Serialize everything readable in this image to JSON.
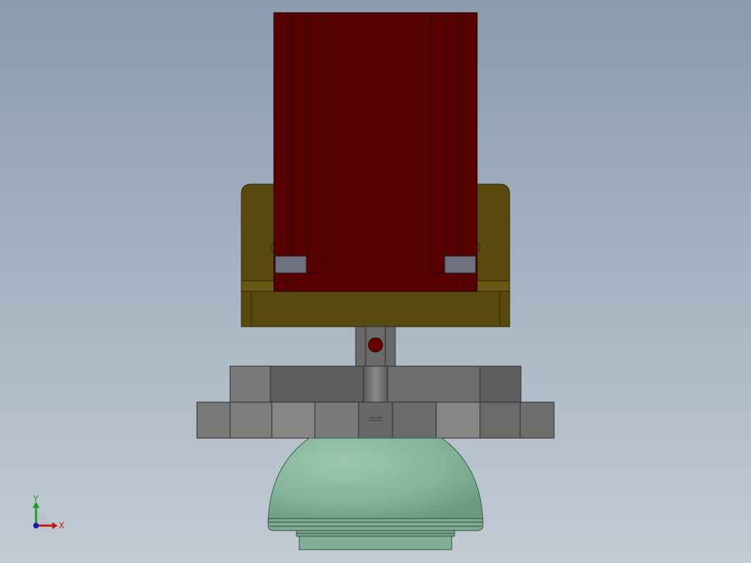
{
  "viewport": {
    "model_colors": {
      "cylinder_body": "#560000",
      "mount_bracket": "#5a4a10",
      "gripper_blocks": "#6e6e6e",
      "suction_cup": "#86b59c",
      "background_top": "#8a9bb0",
      "background_bottom": "#c2cbd4"
    }
  },
  "triad": {
    "x_label": "X",
    "y_label": "Y",
    "x_color": "#c01818",
    "y_color": "#18a018",
    "z_color": "#1818b0"
  }
}
